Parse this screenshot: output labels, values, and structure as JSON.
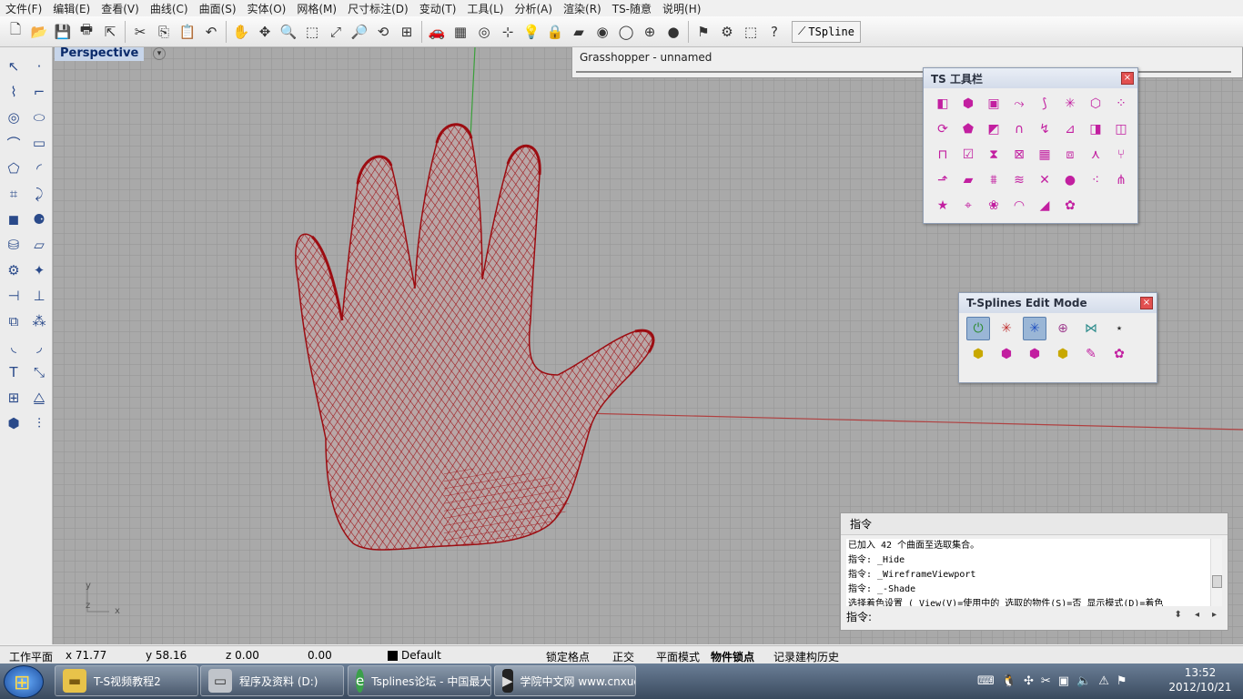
{
  "menu": [
    "文件(F)",
    "编辑(E)",
    "查看(V)",
    "曲线(C)",
    "曲面(S)",
    "实体(O)",
    "网格(M)",
    "尺寸标注(D)",
    "变动(T)",
    "工具(L)",
    "分析(A)",
    "渲染(R)",
    "TS-随意",
    "说明(H)"
  ],
  "toolbar": {
    "icons": [
      "new-file-icon",
      "open-folder-icon",
      "save-icon",
      "print-icon",
      "import-icon",
      "cut-icon",
      "copy-icon",
      "paste-icon",
      "undo-icon",
      "pan-hand-icon",
      "rotate-view-icon",
      "zoom-icon",
      "zoom-window-icon",
      "zoom-extents-icon",
      "zoom-selected-icon",
      "rotate-icon",
      "four-view-icon",
      "car-icon",
      "grid-icon",
      "circle-target-icon",
      "snap-icon",
      "light-bulb-icon",
      "lock-icon",
      "layer-icon",
      "color-wheel-icon",
      "wireframe-sphere-icon",
      "render-sphere-icon",
      "shaded-sphere-icon",
      "flag-icon",
      "gear-icon",
      "options-icon",
      "help-icon"
    ],
    "glyphs": [
      "🗋",
      "📂",
      "💾",
      "🖶",
      "⇱",
      "✂",
      "⎘",
      "📋",
      "↶",
      "✋",
      "✥",
      "🔍",
      "⬚",
      "⤢",
      "🔎",
      "⟲",
      "⊞",
      "🚗",
      "▦",
      "◎",
      "⊹",
      "💡",
      "🔒",
      "▰",
      "◉",
      "◯",
      "⊕",
      "●",
      "⚑",
      "⚙",
      "⬚",
      "?"
    ],
    "tspline_label": "TSpline"
  },
  "left_tools": {
    "icons": [
      "select-arrow-icon",
      "point-icon",
      "polyline-icon",
      "rectangle-corner-icon",
      "circle-icon",
      "ellipse-icon",
      "curve-icon",
      "rectangle-icon",
      "polygon-icon",
      "arc-icon",
      "surface-edit-icon",
      "twist-icon",
      "box-icon",
      "spheres-icon",
      "cylinder-icon",
      "plane-surface-icon",
      "gears-icon",
      "explode-icon",
      "trim-icon",
      "split-icon",
      "boolean-icon",
      "group-icon",
      "fillet-icon",
      "blend-icon",
      "text-icon",
      "scale-icon",
      "array-icon",
      "mirror-icon",
      "solid-icon",
      "dimension-icon"
    ],
    "glyphs": [
      "↖",
      "·",
      "⌇",
      "⌐",
      "◎",
      "⬭",
      "⌒",
      "▭",
      "⬠",
      "◜",
      "⌗",
      "⤸",
      "◼",
      "⚈",
      "⛁",
      "▱",
      "⚙",
      "✦",
      "⊣",
      "⊥",
      "⧉",
      "⁂",
      "◟",
      "◞",
      "T",
      "⤡",
      "⊞",
      "⧋",
      "⬢",
      "⫶"
    ]
  },
  "viewport": {
    "title": "Perspective",
    "axis_y": "y",
    "axis_z": "z",
    "axis_x": "x"
  },
  "grasshopper": {
    "title": "Grasshopper - unnamed"
  },
  "ts_panel": {
    "title": "TS 工具栏",
    "close": "×",
    "icons": [
      "ts-box-icon",
      "ts-cube-icon",
      "ts-frame-icon",
      "ts-curve-icon",
      "ts-pipe-icon",
      "ts-axis-icon",
      "ts-extrude-icon",
      "ts-dots-icon",
      "ts-cycle-icon",
      "ts-pentagon-icon",
      "ts-quad-icon",
      "ts-arch-icon",
      "ts-bend-icon",
      "ts-fold-icon",
      "ts-split-face-icon",
      "ts-merge-icon",
      "ts-bridge-icon",
      "ts-check-icon",
      "ts-weld-icon",
      "ts-grid-x-icon",
      "ts-grid-icon",
      "ts-layer-icon",
      "ts-crease-icon",
      "ts-branch-icon",
      "ts-arrow-face-icon",
      "ts-slant-icon",
      "ts-fill-icon",
      "ts-wave-icon",
      "ts-cross-icon",
      "ts-solid-icon",
      "ts-scatter-icon",
      "ts-connect-icon",
      "ts-star-icon",
      "ts-target-icon",
      "ts-petal-icon",
      "ts-ring-icon",
      "ts-strip-icon",
      "ts-gear-icon"
    ],
    "glyphs": [
      "◧",
      "⬢",
      "▣",
      "⤳",
      "⟆",
      "✳",
      "⬡",
      "⁘",
      "⟳",
      "⬟",
      "◩",
      "∩",
      "↯",
      "⊿",
      "◨",
      "◫",
      "⊓",
      "☑",
      "⧗",
      "⊠",
      "▦",
      "⧈",
      "⋏",
      "⑂",
      "⬏",
      "▰",
      "⩩",
      "≋",
      "✕",
      "●",
      "⁖",
      "⋔",
      "★",
      "⌖",
      "❀",
      "◠",
      "◢",
      "✿"
    ]
  },
  "edit_panel": {
    "title": "T-Splines Edit Mode",
    "close": "×",
    "icons": [
      "power-icon",
      "axis-world-icon",
      "axis-local-icon",
      "sphere-grid-icon",
      "nodes-icon",
      "scatter-axis-icon",
      "face-cube-icon",
      "edge-cube-icon",
      "vertex-cube-icon",
      "all-cube-icon",
      "brush-icon",
      "gear-pink-icon"
    ],
    "glyphs": [
      "⏻",
      "✳",
      "✳",
      "⊕",
      "⋈",
      "⋆",
      "⬢",
      "⬢",
      "⬢",
      "⬢",
      "✎",
      "✿"
    ]
  },
  "command": {
    "title": "指令",
    "log": [
      "已加入 42 个曲面至选取集合。",
      "指令: _Hide",
      "指令: _WireframeViewport",
      "指令: _-Shade",
      "选择着色设置 ( View(V)=使用中的  选取的物件(S)=否  显示模式(D)=着色"
    ],
    "prompt": "指令:",
    "input_value": ""
  },
  "status": {
    "plane": "工作平面",
    "x": "x 71.77",
    "y": "y 58.16",
    "z": "z 0.00",
    "d": "0.00",
    "layer": "Default",
    "layer_color": "#000000",
    "toggles": [
      "锁定格点",
      "正交",
      "平面模式",
      "物件锁点",
      "记录建构历史"
    ]
  },
  "taskbar": {
    "tasks": [
      "T-S视频教程2",
      "程序及资料 (D:)",
      "Tsplines论坛 - 中国最大的Rhino技术交流平台",
      "学院中文网 www.cnxuexi.com - 国内最大的Rhino技术交流平台"
    ],
    "task_icons": [
      "folder-icon",
      "drive-icon",
      "browser-icon",
      "video-icon"
    ],
    "tray_icons": [
      "keyboard-icon",
      "qq-icon",
      "network-icon",
      "tools-icon",
      "monitor-icon",
      "volume-icon",
      "security-icon",
      "flag-icon"
    ],
    "tray_glyphs": [
      "⌨",
      "🐧",
      "✣",
      "✂",
      "▣",
      "🔈",
      "⚠",
      "⚑"
    ],
    "time": "13:52",
    "date": "2012/10/21"
  },
  "colors": {
    "mesh": "#9c0d12",
    "x_axis": "#b04040",
    "y_axis": "#3aa03a"
  }
}
